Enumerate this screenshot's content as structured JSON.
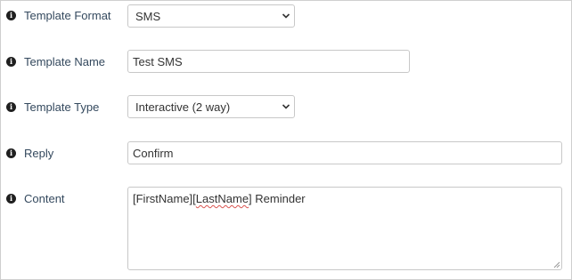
{
  "form": {
    "template_format": {
      "label": "Template Format",
      "value": "SMS"
    },
    "template_name": {
      "label": "Template Name",
      "value": "Test SMS"
    },
    "template_type": {
      "label": "Template Type",
      "value": "Interactive (2 way)"
    },
    "reply": {
      "label": "Reply",
      "value": "Confirm"
    },
    "content": {
      "label": "Content",
      "value_part1": "[FirstName][",
      "value_misspelled": "LastName",
      "value_part2": "] Reminder"
    }
  },
  "icons": {
    "info": "info-circle-icon",
    "select_arrow": "chevron-down-icon",
    "resize": "resize-handle-icon"
  },
  "colors": {
    "label": "#34495e",
    "border": "#c8c8c8",
    "spellcheck": "#d9534f"
  }
}
